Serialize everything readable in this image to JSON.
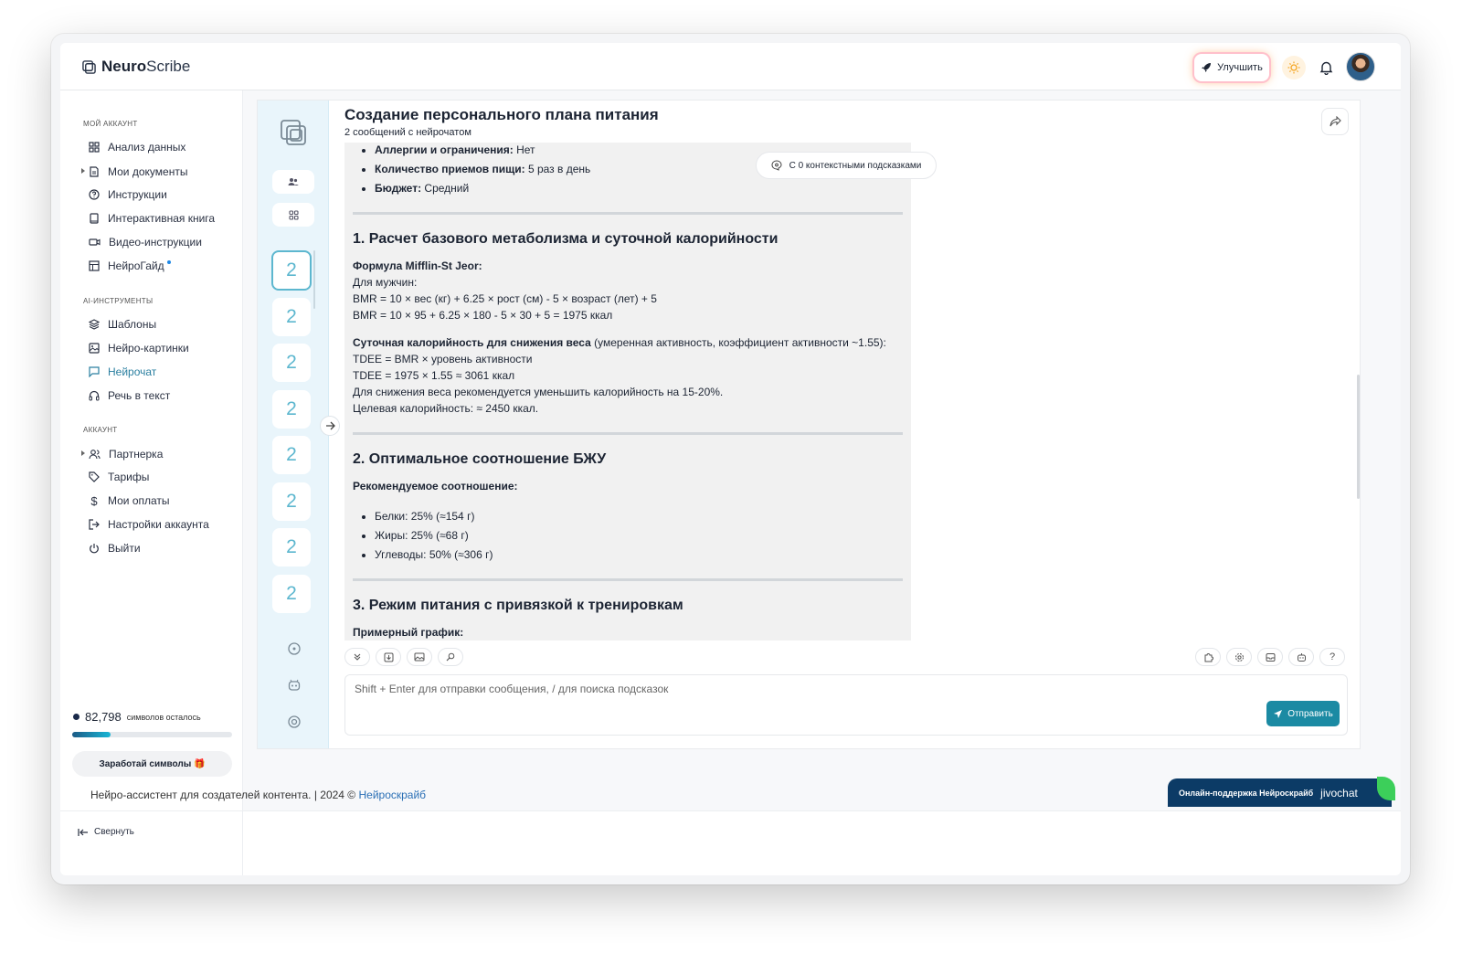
{
  "app": {
    "brand_bold": "Neuro",
    "brand_rest": "Scribe"
  },
  "header": {
    "upgrade_label": "Улучшить"
  },
  "sidebar": {
    "section_account": "МОЙ АККАУНТ",
    "section_ai": "AI-ИНСТРУМЕНТЫ",
    "section_acc2": "АККАУНТ",
    "items": [
      {
        "label": "Анализ данных"
      },
      {
        "label": "Мои документы"
      },
      {
        "label": "Инструкции"
      },
      {
        "label": "Интерактивная книга"
      },
      {
        "label": "Видео-инструкции"
      },
      {
        "label": "НейроГайд"
      },
      {
        "label": "Шаблоны"
      },
      {
        "label": "Нейро-картинки"
      },
      {
        "label": "Нейрочат"
      },
      {
        "label": "Речь в текст"
      },
      {
        "label": "Партнерка"
      },
      {
        "label": "Тарифы"
      },
      {
        "label": "Мои оплаты"
      },
      {
        "label": "Настройки аккаунта"
      },
      {
        "label": "Выйти"
      }
    ],
    "credits_value": "82,798",
    "credits_label": "символов осталось",
    "credits_fraction": 0.24,
    "earn_label": "Заработай символы 🎁",
    "collapse_label": "Свернуть"
  },
  "chat": {
    "title": "Создание персонального плана питания",
    "subtitle": "2 сообщений с нейрочатом",
    "context_chip": "С 0 контекстными подсказками",
    "thumb_label": "2",
    "message": {
      "b1_k": "Аллергии и ограничения:",
      "b1_v": " Нет",
      "b2_k": "Количество приемов пищи:",
      "b2_v": " 5 раз в день",
      "b3_k": "Бюджет:",
      "b3_v": " Средний",
      "h1": "1. Расчет базового метаболизма и суточной калорийности",
      "formula_title": "Формула Mifflin-St Jeor:",
      "for_men": "Для мужчин:",
      "bmr_formula": "BMR = 10 × вес (кг) + 6.25 × рост (см) - 5 × возраст (лет) + 5",
      "bmr_calc": "BMR = 10 × 95 + 6.25 × 180 - 5 × 30 + 5 = 1975 ккал",
      "tdee_title": "Суточная калорийность для снижения веса",
      "tdee_note": " (умеренная активность, коэффициент активности ~1.55):",
      "tdee_formula": "TDEE = BMR × уровень активности",
      "tdee_calc": "TDEE = 1975 × 1.55 ≈ 3061 ккал",
      "reduce_note": "Для снижения веса рекомендуется уменьшить калорийность на 15-20%.",
      "target": "Целевая калорийность: ≈ 2450 ккал.",
      "h2": "2. Оптимальное соотношение БЖУ",
      "ratio_title": "Рекомендуемое соотношение:",
      "protein": "Белки: 25% (≈154 г)",
      "fat": "Жиры: 25% (≈68 г)",
      "carbs": "Углеводы: 50% (≈306 г)",
      "h3": "3. Режим питания с привязкой к тренировкам",
      "schedule_title": "Примерный график:"
    },
    "input_placeholder": "Shift + Enter для отправки сообщения, / для поиска подсказок",
    "send_label": "Отправить"
  },
  "footer": {
    "text": "Нейро-ассистент для создателей контента.  | 2024 © ",
    "link": "Нейроскрайб",
    "support": "Онлайн-поддержка Нейроскрайб",
    "jivo": "jivochat"
  }
}
